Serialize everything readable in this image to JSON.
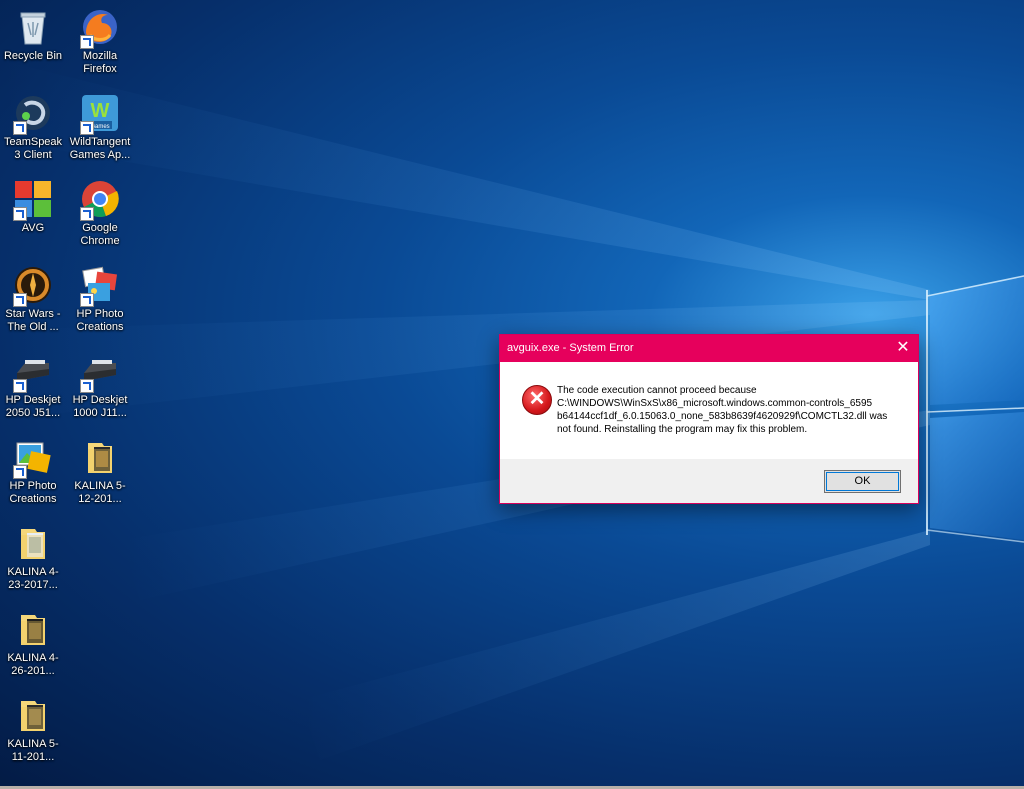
{
  "desktop": {
    "icons": [
      {
        "label": "Recycle Bin",
        "icon": "recycle-bin-icon"
      },
      {
        "label": "Mozilla Firefox",
        "icon": "firefox-icon"
      },
      {
        "label": "TeamSpeak 3 Client",
        "icon": "teamspeak-icon"
      },
      {
        "label": "WildTangent Games Ap...",
        "icon": "wildtangent-icon",
        "sublabel": "Games"
      },
      {
        "label": "AVG",
        "icon": "avg-icon"
      },
      {
        "label": "Google Chrome",
        "icon": "chrome-icon"
      },
      {
        "label": "Star Wars - The Old ...",
        "icon": "star-wars-icon"
      },
      {
        "label": "HP Photo Creations",
        "icon": "hp-photo-creations-icon"
      },
      {
        "label": "HP Deskjet 2050 J51...",
        "icon": "printer-icon"
      },
      {
        "label": "HP Deskjet 1000 J11...",
        "icon": "printer-icon"
      },
      {
        "label": "HP Photo Creations",
        "icon": "hp-photo-creations-icon"
      },
      {
        "label": "KALINA 5-12-201...",
        "icon": "folder-icon"
      },
      {
        "label": "KALINA 4-23-2017...",
        "icon": "folder-icon"
      },
      {
        "label": "KALINA 4-26-201...",
        "icon": "folder-icon"
      },
      {
        "label": "KALINA 5-11-201...",
        "icon": "folder-icon"
      }
    ]
  },
  "dialog": {
    "title": "avguix.exe - System Error",
    "close_glyph": "✕",
    "error_glyph": "✕",
    "message_lines": [
      "The code execution cannot proceed because",
      "C:\\WINDOWS\\WinSxS\\x86_microsoft.windows.common-controls_6595",
      "b64144ccf1df_6.0.15063.0_none_583b8639f4620929f\\COMCTL32.dll was",
      "not found. Reinstalling the program may fix this problem."
    ],
    "ok_label": "OK"
  },
  "colors": {
    "titlebar": "#e6005c",
    "error": "#d4171b"
  }
}
